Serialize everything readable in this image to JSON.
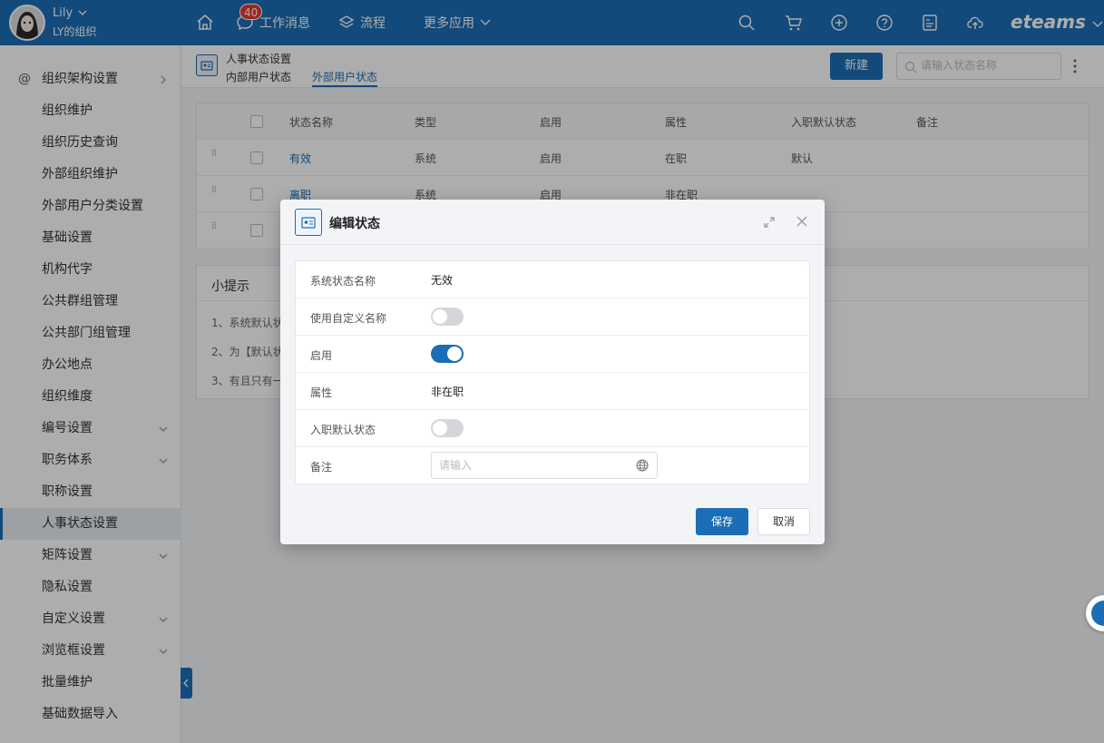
{
  "user": {
    "name": "Lily",
    "org": "LY的组织"
  },
  "topnav": {
    "messages_label": "工作消息",
    "messages_badge": "40",
    "workflow_label": "流程",
    "more_apps_label": "更多应用",
    "brand": "eteams"
  },
  "sidebar": {
    "items": [
      {
        "label": "组织架构设置",
        "chevron": "right"
      },
      {
        "label": "组织维护"
      },
      {
        "label": "组织历史查询"
      },
      {
        "label": "外部组织维护"
      },
      {
        "label": "外部用户分类设置"
      },
      {
        "label": "基础设置"
      },
      {
        "label": "机构代字"
      },
      {
        "label": "公共群组管理"
      },
      {
        "label": "公共部门组管理"
      },
      {
        "label": "办公地点"
      },
      {
        "label": "组织维度"
      },
      {
        "label": "编号设置",
        "chevron": "down"
      },
      {
        "label": "职务体系",
        "chevron": "down"
      },
      {
        "label": "职称设置"
      },
      {
        "label": "人事状态设置",
        "active": true
      },
      {
        "label": "矩阵设置",
        "chevron": "down"
      },
      {
        "label": "隐私设置"
      },
      {
        "label": "自定义设置",
        "chevron": "down"
      },
      {
        "label": "浏览框设置",
        "chevron": "down"
      },
      {
        "label": "批量维护"
      },
      {
        "label": "基础数据导入"
      }
    ]
  },
  "header": {
    "title": "人事状态设置",
    "tabs": [
      {
        "label": "内部用户状态"
      },
      {
        "label": "外部用户状态",
        "active": true
      }
    ],
    "new_button": "新建",
    "search_placeholder": "请输入状态名称"
  },
  "table": {
    "columns": [
      "状态名称",
      "类型",
      "启用",
      "属性",
      "入职默认状态",
      "备注"
    ],
    "rows": [
      {
        "name": "有效",
        "type": "系统",
        "enabled": "启用",
        "attr": "在职",
        "default": "默认",
        "remark": ""
      },
      {
        "name": "离职",
        "type": "系统",
        "enabled": "启用",
        "attr": "非在职",
        "default": "",
        "remark": ""
      },
      {
        "name": "",
        "type": "",
        "enabled": "",
        "attr": "",
        "default": "",
        "remark": ""
      }
    ]
  },
  "tips": {
    "title": "小提示",
    "items": [
      "1、系统默认状",
      "2、为【默认状",
      "3、有且只有一"
    ]
  },
  "modal": {
    "title": "编辑状态",
    "fields": {
      "system_name_label": "系统状态名称",
      "system_name_value": "无效",
      "custom_name_label": "使用自定义名称",
      "custom_name_on": false,
      "enabled_label": "启用",
      "enabled_on": true,
      "attr_label": "属性",
      "attr_value": "非在职",
      "default_label": "入职默认状态",
      "default_on": false,
      "remark_label": "备注",
      "remark_placeholder": "请输入"
    },
    "save_button": "保存",
    "cancel_button": "取消"
  },
  "colors": {
    "primary": "#1b6eb6",
    "badge": "#e6392b"
  }
}
